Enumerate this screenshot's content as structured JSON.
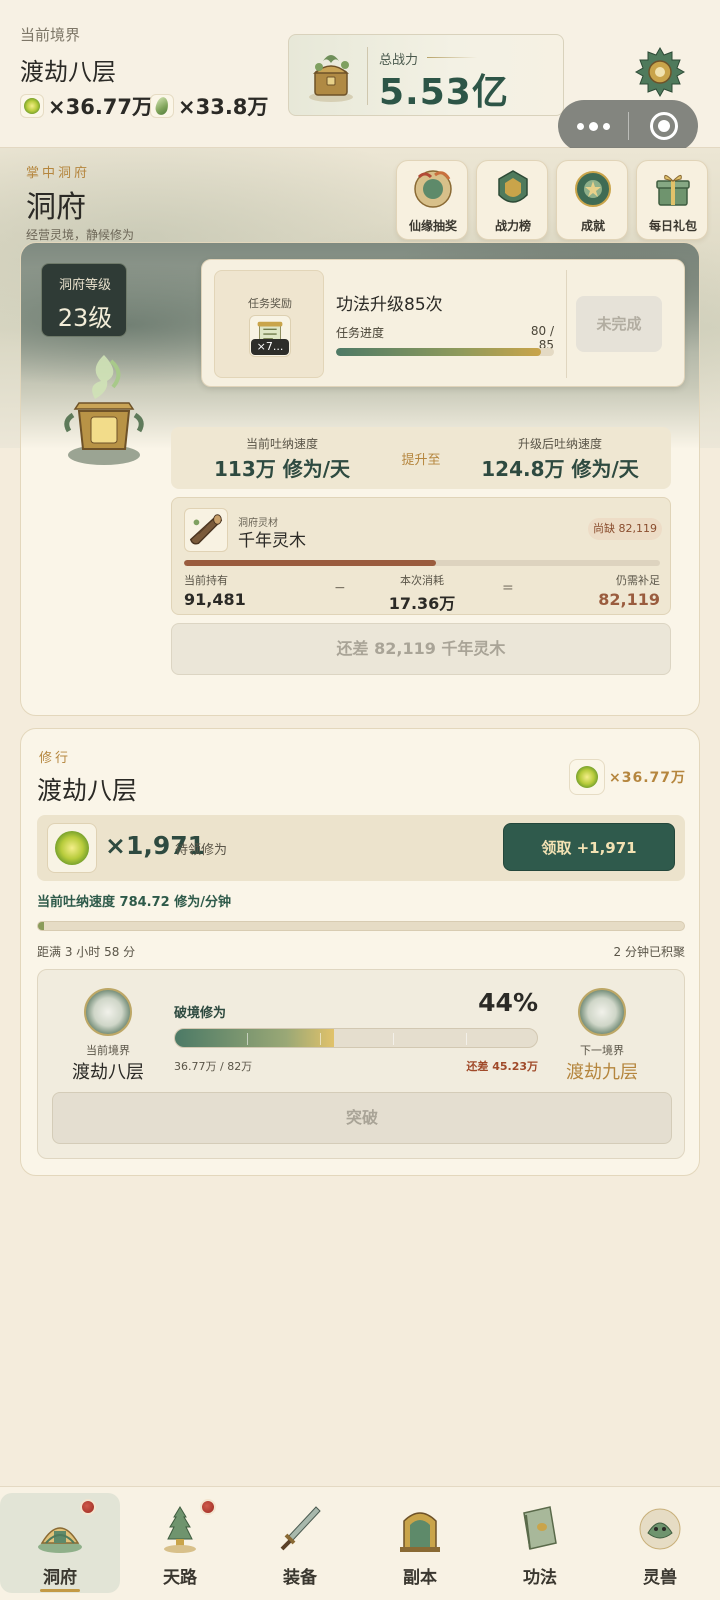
{
  "header": {
    "realm_label": "当前境界",
    "realm_name": "渡劫八层",
    "resource_1": "×36.77万",
    "resource_2": "×33.8万",
    "power_label": "总战力",
    "power_value": "5.53亿",
    "icons": [
      "spirit-orb-icon",
      "spirit-leaf-icon",
      "treasure-chest-icon",
      "gear-settings-icon",
      "more-dots-icon",
      "close-target-icon"
    ]
  },
  "dongfu": {
    "tag": "掌中洞府",
    "title": "洞府",
    "subtitle": "经营灵境，静候修为",
    "quick_buttons": [
      {
        "label": "仙缘抽奖",
        "icon": "lottery-icon"
      },
      {
        "label": "战力榜",
        "icon": "ranking-icon"
      },
      {
        "label": "成就",
        "icon": "achievement-icon"
      },
      {
        "label": "每日礼包",
        "icon": "gift-box-icon"
      }
    ],
    "level_label": "洞府等级",
    "level_value": "23级",
    "task": {
      "reward_label": "任务奖励",
      "reward_count": "×7...",
      "name": "功法升级85次",
      "progress_label": "任务进度",
      "progress_text": "80 / 85",
      "progress_fraction": 0.94,
      "button": "未完成"
    },
    "speed": {
      "current_label": "当前吐纳速度",
      "current_value": "113万 修为/天",
      "arrow": "提升至",
      "next_label": "升级后吐纳速度",
      "next_value": "124.8万 修为/天"
    },
    "material": {
      "tag": "洞府灵材",
      "name": "千年灵木",
      "short_badge": "尚缺 82,119",
      "progress_fraction": 0.53,
      "have_label": "当前持有",
      "have_value": "91,481",
      "minus": "−",
      "cost_label": "本次消耗",
      "cost_value": "17.36万",
      "equals": "=",
      "need_label": "仍需补足",
      "need_value": "82,119"
    },
    "lack_button": "还差 82,119 千年灵木"
  },
  "cultivation": {
    "tag": "修行",
    "title": "渡劫八层",
    "resource": "×36.77万",
    "pending_value": "×1,971",
    "pending_label": "待领修为",
    "claim_button": "领取 +1,971",
    "rate_text": "当前吐纳速度 784.72 修为/分钟",
    "full_fraction": 0.01,
    "full_left": "距满 3 小时 58 分",
    "full_right": "2 分钟已积聚",
    "breakthrough": {
      "current_label": "当前境界",
      "current_realm": "渡劫八层",
      "title": "破境修为",
      "percent": "44%",
      "fraction": 0.44,
      "current_amount": "36.77万 / 82万",
      "need": "还差 45.23万",
      "next_label": "下一境界",
      "next_realm": "渡劫九层",
      "button": "突破"
    }
  },
  "nav": [
    {
      "label": "洞府",
      "icon": "dongfu-icon",
      "badge": true,
      "active": true
    },
    {
      "label": "天路",
      "icon": "tianlu-icon",
      "badge": true,
      "active": false
    },
    {
      "label": "装备",
      "icon": "sword-icon",
      "badge": false,
      "active": false
    },
    {
      "label": "副本",
      "icon": "gate-icon",
      "badge": false,
      "active": false
    },
    {
      "label": "功法",
      "icon": "book-icon",
      "badge": false,
      "active": false
    },
    {
      "label": "灵兽",
      "icon": "beast-icon",
      "badge": false,
      "active": false
    }
  ],
  "colors": {
    "accent_green": "#2f5a4c",
    "accent_gold": "#b5863e",
    "background": "#f4ecdc",
    "warning_red": "#a04a2a"
  }
}
